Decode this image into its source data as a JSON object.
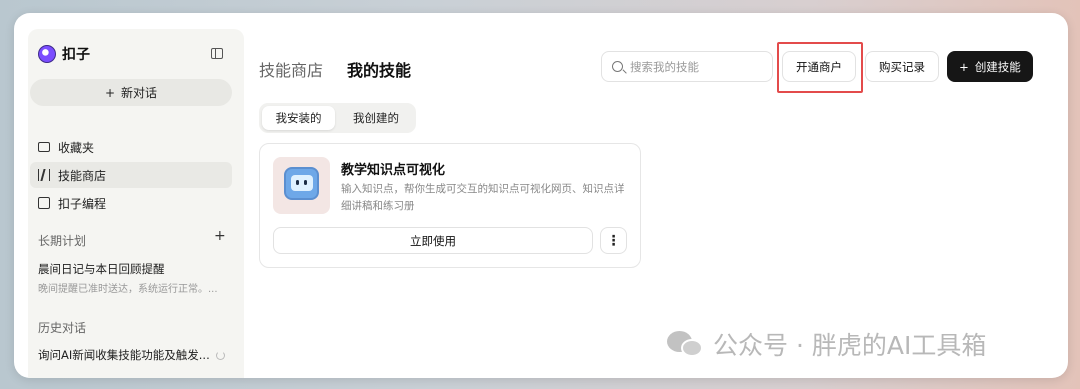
{
  "sidebar": {
    "brand": "扣子",
    "new_chat": "新对话",
    "nav": [
      {
        "label": "收藏夹",
        "icon": "folder-icon"
      },
      {
        "label": "技能商店",
        "icon": "books-icon"
      },
      {
        "label": "扣子编程",
        "icon": "code-icon"
      }
    ],
    "long_term": {
      "title": "长期计划",
      "item_title": "晨间日记与本日回顾提醒",
      "item_sub": "晚间提醒已准时送达，系统运行正常。..."
    },
    "history": {
      "title": "历史对话",
      "item": "询问AI新闻收集技能功能及触发..."
    }
  },
  "header": {
    "tab_store": "技能商店",
    "tab_mine": "我的技能",
    "search_placeholder": "搜索我的技能",
    "btn_merchant": "开通商户",
    "btn_records": "购买记录",
    "btn_create": "创建技能"
  },
  "segments": {
    "installed": "我安装的",
    "created": "我创建的"
  },
  "card": {
    "title": "教学知识点可视化",
    "description": "输入知识点，帮你生成可交互的知识点可视化网页、知识点详细讲稿和练习册",
    "use_button": "立即使用",
    "more_button": "⋮"
  },
  "watermark": "公众号 · 胖虎的AI工具箱",
  "colors": {
    "highlight": "#e34b4b",
    "primary_button": "#161616"
  }
}
